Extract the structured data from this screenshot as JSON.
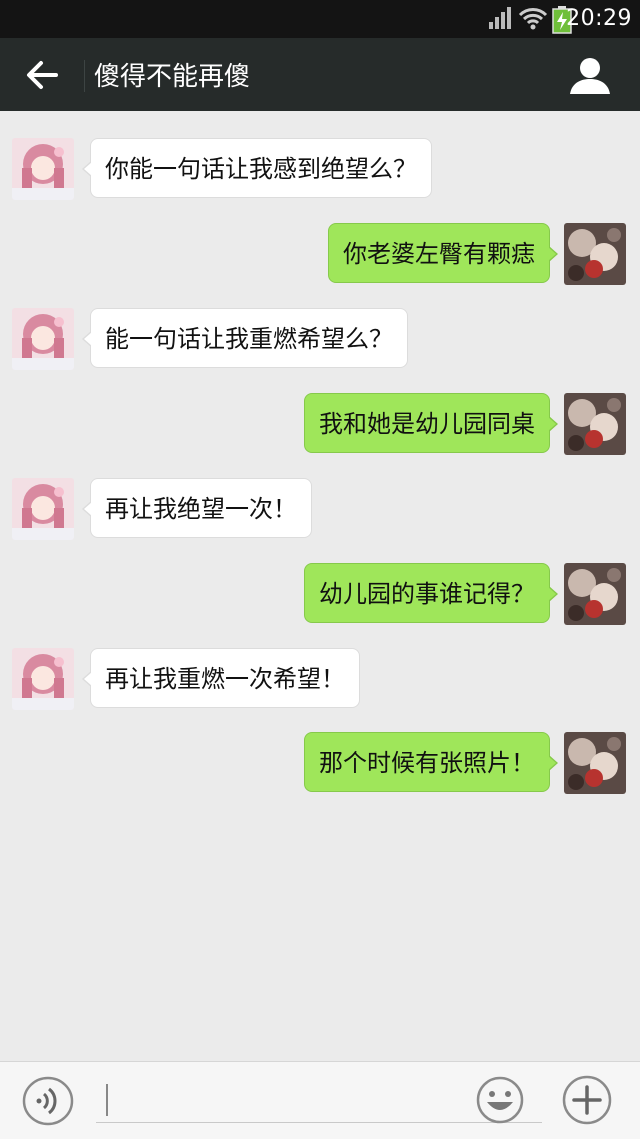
{
  "status_bar": {
    "time": "20:29"
  },
  "header": {
    "title": "傻得不能再傻",
    "back_icon": "back-arrow-icon",
    "profile_icon": "person-icon"
  },
  "colors": {
    "header_bg": "#262b2a",
    "chat_bg": "#ebebeb",
    "sent_bubble": "#9fe65a",
    "received_bubble": "#ffffff"
  },
  "messages": [
    {
      "side": "left",
      "text": "你能一句话让我感到绝望么？"
    },
    {
      "side": "right",
      "text": "你老婆左臀有颗痣"
    },
    {
      "side": "left",
      "text": "能一句话让我重燃希望么？"
    },
    {
      "side": "right",
      "text": "我和她是幼儿园同桌"
    },
    {
      "side": "left",
      "text": "再让我绝望一次！"
    },
    {
      "side": "right",
      "text": "幼儿园的事谁记得？"
    },
    {
      "side": "left",
      "text": "再让我重燃一次希望！"
    },
    {
      "side": "right",
      "text": "那个时候有张照片！"
    }
  ],
  "input_bar": {
    "voice_icon": "voice-icon",
    "emoji_icon": "emoji-icon",
    "more_icon": "plus-icon",
    "value": ""
  }
}
